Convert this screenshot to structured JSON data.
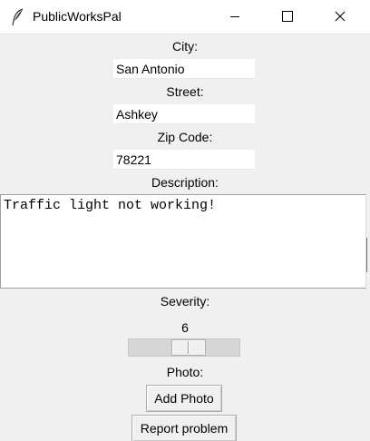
{
  "window": {
    "title": "PublicWorksPal"
  },
  "form": {
    "city_label": "City:",
    "city_value": "San Antonio",
    "street_label": "Street:",
    "street_value": "Ashkey",
    "zip_label": "Zip Code:",
    "zip_value": "78221",
    "description_label": "Description:",
    "description_value": "Traffic light not working!",
    "severity_label": "Severity:",
    "severity_value": "6",
    "photo_label": "Photo:",
    "add_photo_label": "Add Photo",
    "report_label": "Report problem"
  },
  "icons": {
    "app": "feather-icon",
    "minimize": "minimize-icon",
    "maximize": "maximize-icon",
    "close": "close-icon"
  }
}
